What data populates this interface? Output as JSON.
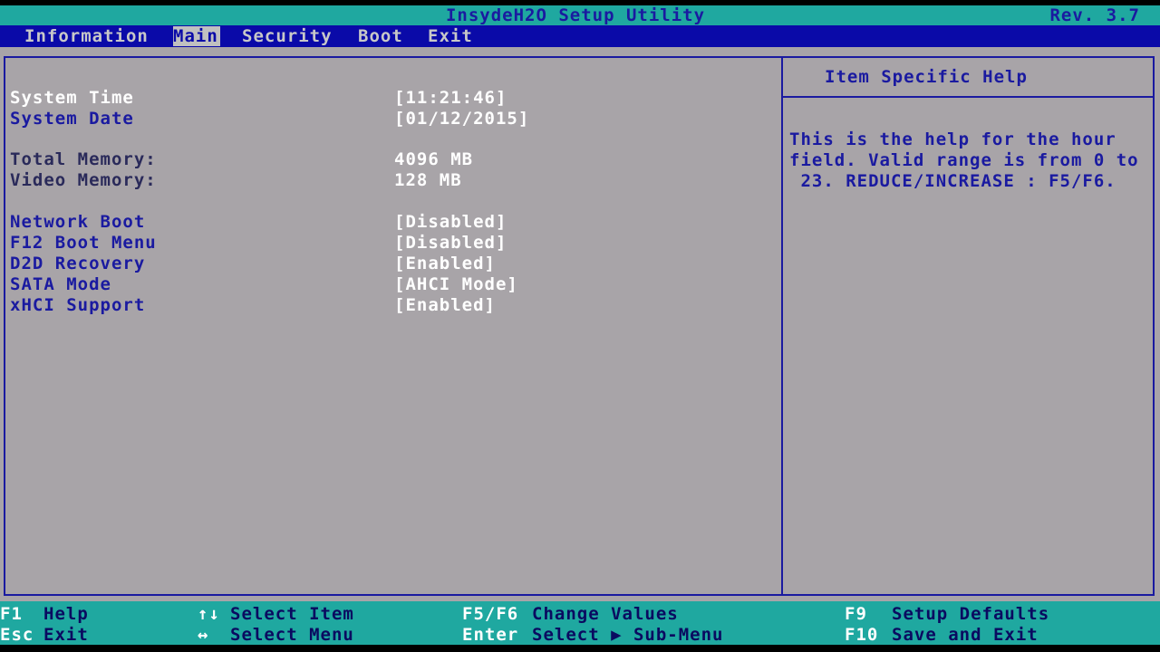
{
  "title": "InsydeH2O Setup Utility",
  "revision": "Rev. 3.7",
  "menu": {
    "information": "Information",
    "main": "Main",
    "security": "Security",
    "boot": "Boot",
    "exit": "Exit",
    "active": "Main"
  },
  "settings": {
    "system_time": {
      "label": "System Time",
      "value": "[11:21:46]"
    },
    "system_date": {
      "label": "System Date",
      "value": "[01/12/2015]"
    },
    "total_memory": {
      "label": "Total Memory:",
      "value": "4096 MB"
    },
    "video_memory": {
      "label": "Video Memory:",
      "value": "128 MB"
    },
    "network_boot": {
      "label": "Network Boot",
      "value": "[Disabled]"
    },
    "f12_boot_menu": {
      "label": "F12 Boot Menu",
      "value": "[Disabled]"
    },
    "d2d_recovery": {
      "label": "D2D Recovery",
      "value": "[Enabled]"
    },
    "sata_mode": {
      "label": "SATA Mode",
      "value": "[AHCI Mode]"
    },
    "xhci_support": {
      "label": "xHCI Support",
      "value": "[Enabled]"
    }
  },
  "help": {
    "heading": "Item Specific Help",
    "line1": "This is the help for the hour",
    "line2": "field. Valid range is from 0 to",
    "line3": " 23. REDUCE/INCREASE : F5/F6."
  },
  "footer": {
    "f1_key": "F1",
    "f1_desc": "Help",
    "esc_key": "Esc",
    "esc_desc": "Exit",
    "updown_key": "↑↓",
    "updown_desc": "Select Item",
    "leftright_key": "↔",
    "leftright_desc": "Select Menu",
    "f5f6_key": "F5/F6",
    "f5f6_desc": "Change Values",
    "enter_key": "Enter",
    "enter_desc": "Select ▶ Sub-Menu",
    "f9_key": "F9",
    "f9_desc": "Setup Defaults",
    "f10_key": "F10",
    "f10_desc": "Save and Exit"
  },
  "colors": {
    "title_bg": "#1fa8a0",
    "menu_bg": "#0a0aa8",
    "panel_bg": "#a8a4a8",
    "accent_blue": "#1a1aa0"
  }
}
